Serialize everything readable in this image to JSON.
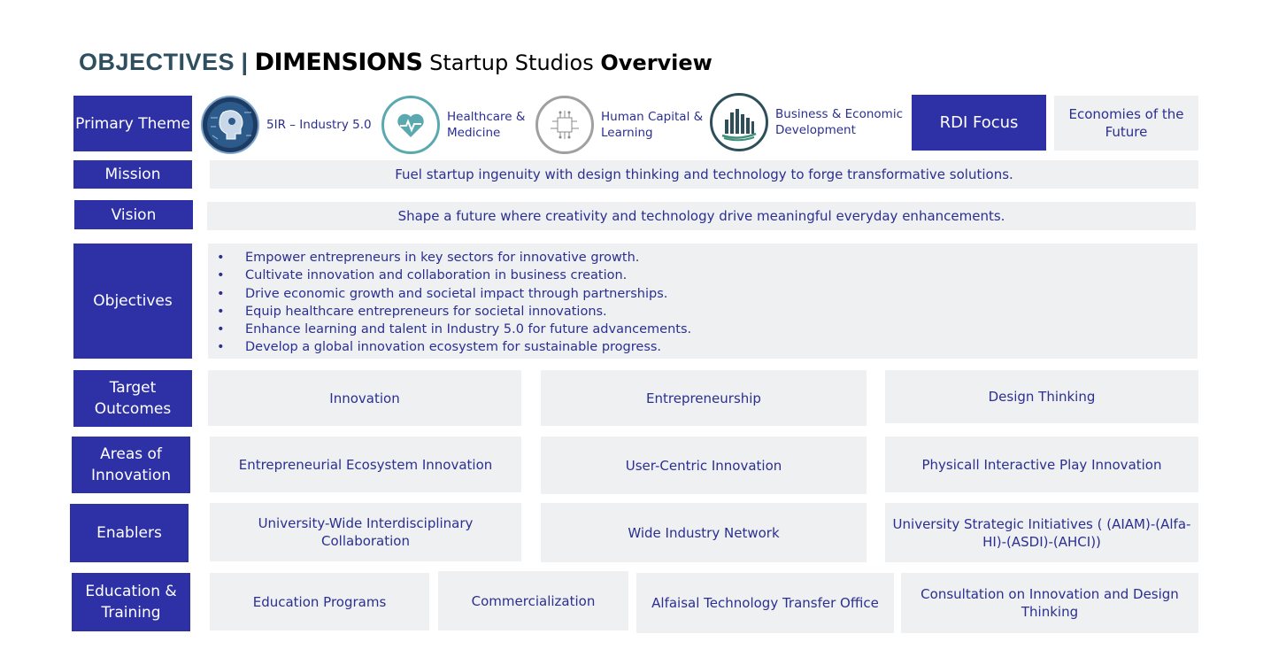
{
  "title": {
    "part1": "OBJECTIVES",
    "separator": " | ",
    "part2": "DIMENSIONS",
    "part3": " Startup Studios ",
    "part4": "Overview"
  },
  "labels": {
    "primary_theme": "Primary Theme",
    "mission": "Mission",
    "vision": "Vision",
    "objectives": "Objectives",
    "target_outcomes": "Target Outcomes",
    "areas_of_innovation": "Areas of Innovation",
    "enablers": "Enablers",
    "education_training": "Education & Training"
  },
  "themes": [
    {
      "label": "5IR –  Industry 5.0",
      "icon": "robot-head-icon"
    },
    {
      "label": "Healthcare & Medicine",
      "icon": "heart-pulse-icon"
    },
    {
      "label": "Human Capital & Learning",
      "icon": "circuit-icon"
    },
    {
      "label": "Business & Economic Development",
      "icon": "city-buildings-icon"
    }
  ],
  "rdi_focus": "RDI Focus",
  "economies": "Economies of the Future",
  "mission_text": "Fuel startup ingenuity with design thinking and technology to forge transformative solutions.",
  "vision_text": "Shape a future where creativity and technology drive meaningful everyday enhancements.",
  "objectives_list": [
    "Empower entrepreneurs in key sectors for innovative growth.",
    "Cultivate innovation and collaboration in business creation.",
    "Drive economic growth and societal impact through partnerships.",
    "Equip healthcare entrepreneurs for societal innovations.",
    "Enhance learning and talent in Industry 5.0 for future advancements.",
    "Develop a global innovation ecosystem for sustainable progress."
  ],
  "target_outcomes": [
    "Innovation",
    "Entrepreneurship",
    "Design Thinking"
  ],
  "areas_of_innovation": [
    "Entrepreneurial Ecosystem Innovation",
    "User-Centric Innovation",
    "Physicall Interactive Play Innovation"
  ],
  "enablers": [
    "University-Wide Interdisciplinary Collaboration",
    "Wide Industry Network",
    "University Strategic Initiatives ( (AIAM)-(Alfa-HI)-(ASDI)-(AHCI))"
  ],
  "education_training": [
    "Education Programs",
    "Commercialization",
    "Alfaisal Technology Transfer Office",
    "Consultation on Innovation and Design Thinking"
  ],
  "colors": {
    "label_bg": "#2e31a6",
    "cell_bg": "#eff0f2",
    "text": "#2b2f8f",
    "title_teal": "#2f4f5f"
  }
}
